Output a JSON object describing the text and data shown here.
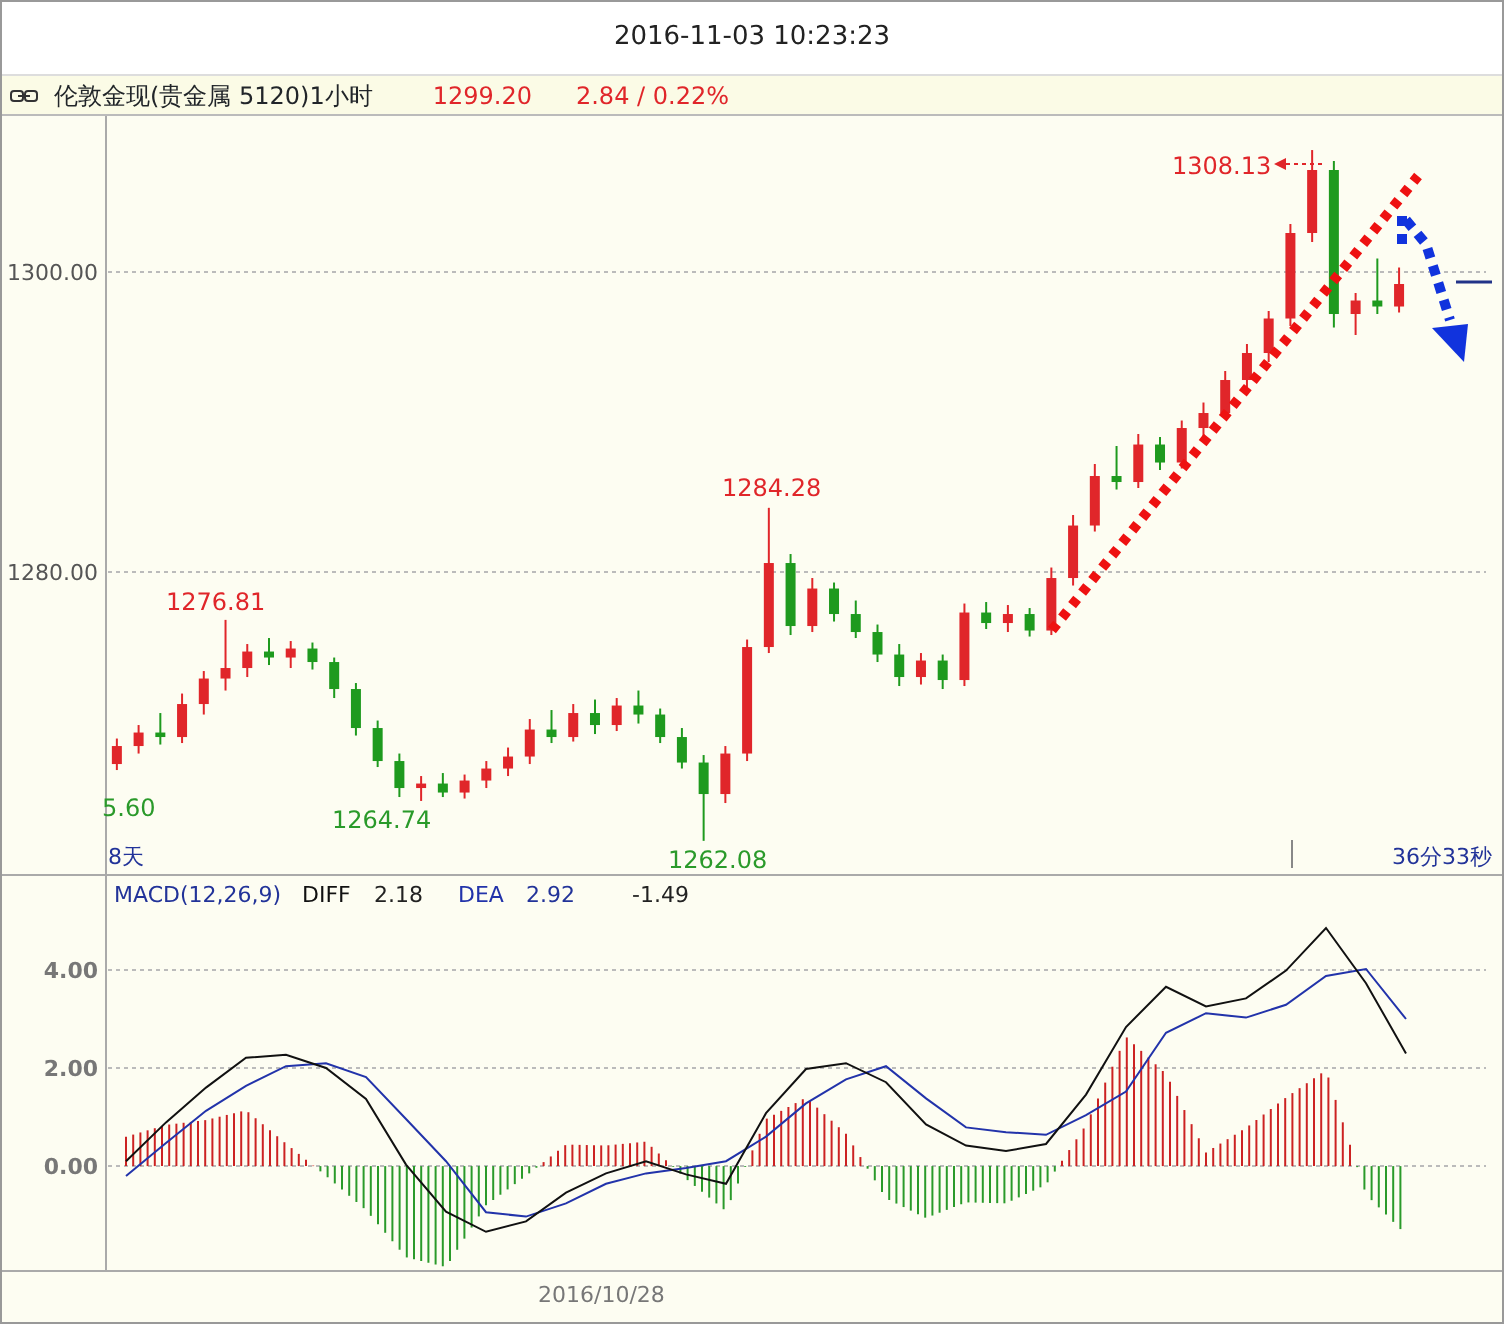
{
  "window": {
    "title": "2016-11-03 10:23:23"
  },
  "instrument_bar": {
    "symbol": "伦敦金现(贵金属 5120)1小时",
    "price": "1299.20",
    "change": "2.84 / 0.22%"
  },
  "price_chart": {
    "annotations": [
      {
        "text": "1308.13",
        "kind": "high"
      },
      {
        "text": "1284.28",
        "kind": "high"
      },
      {
        "text": "1276.81",
        "kind": "high"
      },
      {
        "text": "5.60",
        "kind": "low"
      },
      {
        "text": "1264.74",
        "kind": "low"
      },
      {
        "text": "1262.08",
        "kind": "low"
      }
    ],
    "period_left": "8天",
    "countdown": "36分33秒",
    "chart_data": {
      "type": "candlestick",
      "categories": [
        null,
        null,
        null,
        null,
        null,
        null,
        null,
        null,
        null,
        null,
        null,
        null,
        null,
        null,
        null,
        null,
        null,
        null,
        null,
        null,
        null,
        null,
        null,
        null,
        null,
        null,
        null,
        null,
        null,
        null,
        null,
        null,
        null,
        null,
        null,
        null,
        null,
        null,
        null,
        null,
        null,
        null,
        null,
        null,
        null,
        null,
        null,
        null,
        null,
        null,
        null,
        null,
        null,
        null,
        null,
        null,
        null,
        null,
        null,
        null
      ],
      "ylim": [
        1259.87,
        1310.4
      ],
      "grid": true,
      "yticks": [
        {
          "value": 1300,
          "label": "1300.00"
        },
        {
          "value": 1280,
          "label": "1280.00"
        }
      ],
      "ohlc": [
        [
          1267.2,
          1268.9,
          1266.8,
          1268.4
        ],
        [
          1268.4,
          1269.8,
          1267.9,
          1269.3
        ],
        [
          1269.3,
          1270.6,
          1268.5,
          1269.0
        ],
        [
          1269.0,
          1271.9,
          1268.6,
          1271.2
        ],
        [
          1271.2,
          1273.4,
          1270.5,
          1272.9
        ],
        [
          1272.9,
          1276.81,
          1272.1,
          1273.6
        ],
        [
          1273.6,
          1275.2,
          1273.0,
          1274.7
        ],
        [
          1274.7,
          1275.6,
          1273.8,
          1274.3
        ],
        [
          1274.3,
          1275.4,
          1273.6,
          1274.9
        ],
        [
          1274.9,
          1275.3,
          1273.5,
          1274.0
        ],
        [
          1274.0,
          1274.3,
          1271.6,
          1272.2
        ],
        [
          1272.2,
          1272.6,
          1269.1,
          1269.6
        ],
        [
          1269.6,
          1270.1,
          1267.0,
          1267.4
        ],
        [
          1267.4,
          1267.9,
          1265.0,
          1265.6
        ],
        [
          1265.6,
          1266.4,
          1264.74,
          1265.9
        ],
        [
          1265.9,
          1266.6,
          1265.0,
          1265.3
        ],
        [
          1265.3,
          1266.5,
          1264.9,
          1266.1
        ],
        [
          1266.1,
          1267.4,
          1265.6,
          1266.9
        ],
        [
          1266.9,
          1268.3,
          1266.4,
          1267.7
        ],
        [
          1267.7,
          1270.2,
          1267.2,
          1269.5
        ],
        [
          1269.5,
          1270.8,
          1268.6,
          1269.0
        ],
        [
          1269.0,
          1271.2,
          1268.7,
          1270.6
        ],
        [
          1270.6,
          1271.5,
          1269.2,
          1269.8
        ],
        [
          1269.8,
          1271.6,
          1269.4,
          1271.1
        ],
        [
          1271.1,
          1272.1,
          1269.9,
          1270.5
        ],
        [
          1270.5,
          1270.9,
          1268.6,
          1269.0
        ],
        [
          1269.0,
          1269.6,
          1266.9,
          1267.3
        ],
        [
          1267.3,
          1267.8,
          1262.08,
          1265.2
        ],
        [
          1265.2,
          1268.4,
          1264.6,
          1267.9
        ],
        [
          1267.9,
          1275.5,
          1267.4,
          1275.0
        ],
        [
          1275.0,
          1284.28,
          1274.6,
          1280.6
        ],
        [
          1280.6,
          1281.2,
          1275.8,
          1276.4
        ],
        [
          1276.4,
          1279.6,
          1276.0,
          1278.9
        ],
        [
          1278.9,
          1279.3,
          1276.7,
          1277.2
        ],
        [
          1277.2,
          1278.1,
          1275.6,
          1276.0
        ],
        [
          1276.0,
          1276.5,
          1274.0,
          1274.5
        ],
        [
          1274.5,
          1275.2,
          1272.4,
          1273.0
        ],
        [
          1273.0,
          1274.6,
          1272.5,
          1274.1
        ],
        [
          1274.1,
          1274.5,
          1272.2,
          1272.8
        ],
        [
          1272.8,
          1277.9,
          1272.4,
          1277.3
        ],
        [
          1277.3,
          1278.0,
          1276.2,
          1276.6
        ],
        [
          1276.6,
          1277.8,
          1276.0,
          1277.2
        ],
        [
          1277.2,
          1277.6,
          1275.7,
          1276.1
        ],
        [
          1276.1,
          1280.3,
          1275.8,
          1279.6
        ],
        [
          1279.6,
          1283.8,
          1279.1,
          1283.1
        ],
        [
          1283.1,
          1287.2,
          1282.7,
          1286.4
        ],
        [
          1286.4,
          1288.4,
          1285.5,
          1286.0
        ],
        [
          1286.0,
          1289.2,
          1285.6,
          1288.5
        ],
        [
          1288.5,
          1289.0,
          1286.8,
          1287.3
        ],
        [
          1287.3,
          1290.1,
          1286.9,
          1289.6
        ],
        [
          1289.6,
          1291.3,
          1288.9,
          1290.6
        ],
        [
          1290.6,
          1293.4,
          1290.2,
          1292.8
        ],
        [
          1292.8,
          1295.2,
          1292.1,
          1294.6
        ],
        [
          1294.6,
          1297.4,
          1294.0,
          1296.9
        ],
        [
          1296.9,
          1303.2,
          1296.4,
          1302.6
        ],
        [
          1302.6,
          1308.13,
          1302.0,
          1306.8
        ],
        [
          1306.8,
          1307.4,
          1296.3,
          1297.2
        ],
        [
          1297.2,
          1298.6,
          1295.8,
          1298.1
        ],
        [
          1298.1,
          1300.9,
          1297.2,
          1297.7
        ],
        [
          1297.7,
          1300.3,
          1297.3,
          1299.2
        ]
      ]
    }
  },
  "macd_panel": {
    "label": "MACD(12,26,9)",
    "diff_value": "2.18",
    "dea_value": "2.92",
    "macd_value": "-1.49",
    "chart_data": {
      "type": "line",
      "categories": [
        null,
        null,
        null,
        null,
        null,
        null,
        null,
        null,
        null,
        null,
        null,
        null,
        null,
        null,
        null,
        null,
        null,
        null,
        null,
        null,
        null,
        null,
        null,
        null,
        null,
        null,
        null,
        null,
        null,
        null,
        null,
        null,
        null
      ],
      "ylim": [
        -2.12,
        5.96
      ],
      "grid": true,
      "series": [
        {
          "name": "DIFF",
          "color": "#111111",
          "values": [
            0.1,
            0.89,
            1.6,
            2.21,
            2.27,
            2.0,
            1.37,
            0.03,
            -0.93,
            -1.34,
            -1.13,
            -0.54,
            -0.15,
            0.1,
            -0.17,
            -0.36,
            1.08,
            1.98,
            2.1,
            1.71,
            0.85,
            0.42,
            0.31,
            0.45,
            1.46,
            2.84,
            3.66,
            3.26,
            3.42,
            3.99,
            4.86,
            3.73,
            2.3
          ]
        },
        {
          "name": "DEA",
          "color": "#2233aa",
          "values": [
            -0.2,
            0.47,
            1.13,
            1.64,
            2.04,
            2.1,
            1.82,
            0.96,
            0.1,
            -0.94,
            -1.03,
            -0.76,
            -0.36,
            -0.15,
            -0.04,
            0.1,
            0.6,
            1.28,
            1.77,
            2.04,
            1.38,
            0.79,
            0.69,
            0.64,
            1.04,
            1.52,
            2.72,
            3.12,
            3.03,
            3.29,
            3.88,
            4.02,
            3.0
          ]
        }
      ],
      "yticks": [
        {
          "value": 4,
          "label": "4.00"
        },
        {
          "value": 2,
          "label": "2.00"
        },
        {
          "value": 0,
          "label": "0.00"
        }
      ]
    }
  },
  "time_axis": {
    "labels": [
      "2016/10/28"
    ]
  }
}
